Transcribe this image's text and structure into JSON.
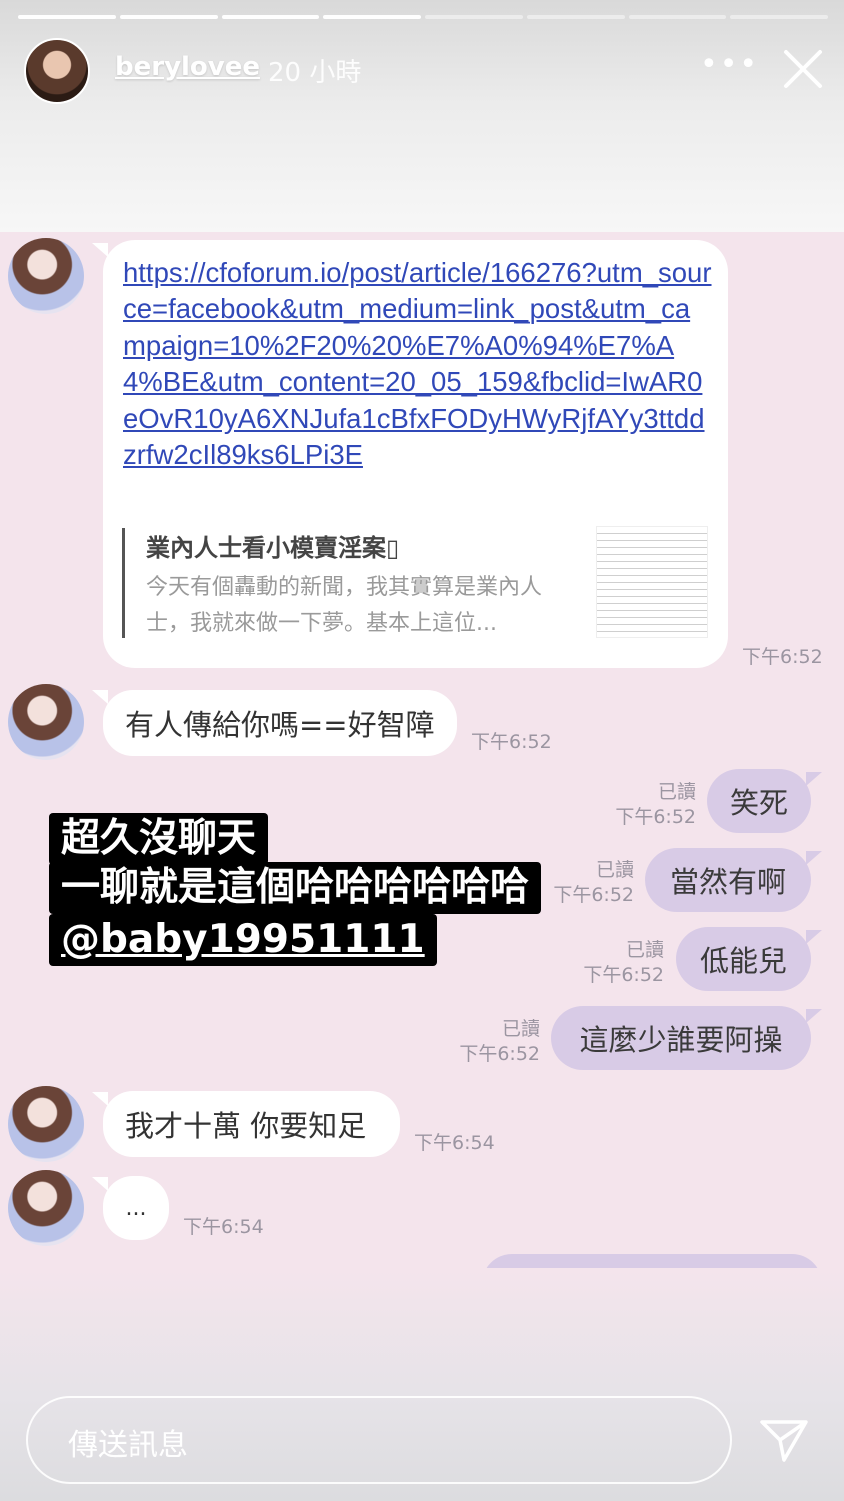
{
  "header": {
    "username": "berylovee",
    "time_ago": "20 小時",
    "more_label": "•••",
    "progress": {
      "total_segments": 8,
      "viewed_segments": 4
    }
  },
  "messages": {
    "link": {
      "url": "https://cfoforum.io/post/article/166276?utm_source=facebook&utm_medium=link_post&utm_campaign=10%2F20%20%E7%A0%94%E7%A4%BE&utm_content=20_05_159&fbclid=IwAR0eOvR10yA6XNJufa1cBfxFODyHWyRjfAYy3ttddzrfw2cIl89ks6LPi3E",
      "preview_title": "業內人士看小模賣淫案▯",
      "preview_desc": "今天有個轟動的新聞，我其實算是業內人士，我就來做一下夢。基本上這位...",
      "time": "下午6:52"
    },
    "in1": {
      "text": "有人傳給你嗎==好智障",
      "time": "下午6:52"
    },
    "out1": {
      "text": "笑死",
      "read": "已讀",
      "time": "下午6:52"
    },
    "out2": {
      "text": "當然有啊",
      "read": "已讀",
      "time": "下午6:52"
    },
    "out3": {
      "text": "低能兒",
      "read": "已讀",
      "time": "下午6:52"
    },
    "out4": {
      "text": "這麼少誰要阿操",
      "read": "已讀",
      "time": "下午6:52"
    },
    "in2": {
      "text": "我才十萬 你要知足",
      "time": "下午6:54"
    },
    "in3": {
      "text": "...",
      "time": "下午6:54"
    }
  },
  "sticker": {
    "line1": "超久沒聊天",
    "line2": "一聊就是這個哈哈哈哈哈哈",
    "mention": "@baby19951111"
  },
  "footer": {
    "input_placeholder": "傳送訊息"
  }
}
